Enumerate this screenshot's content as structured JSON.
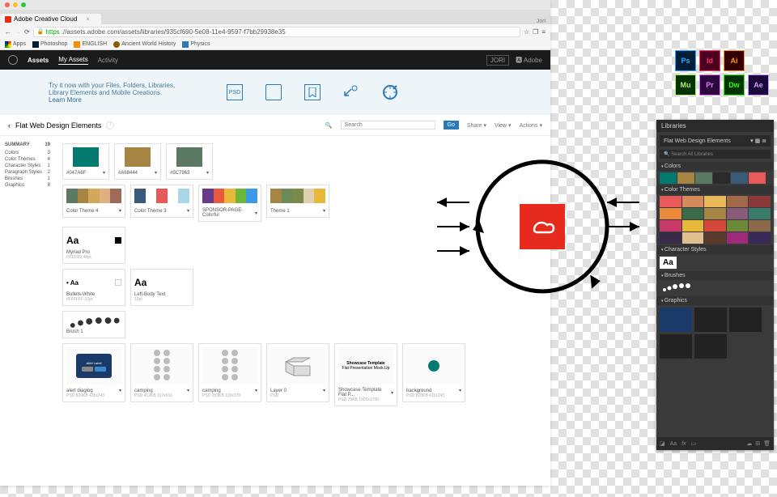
{
  "browser": {
    "tab_title": "Adobe Creative Cloud",
    "url_prefix": "https",
    "url": "://assets.adobe.com/assets/libraries/935cf690-5e08-11e4-9597-f7bb29938e35",
    "user": "Jori",
    "bookmarks": [
      "Apps",
      "Photoshop",
      "ENGLISH",
      "Ancient World History",
      "Physics"
    ]
  },
  "topbar": {
    "brand": "Assets",
    "tabs": [
      "My Assets",
      "Activity"
    ],
    "user": "JORI",
    "adobe": "Adobe"
  },
  "promo": {
    "text": "Try it now with your Files, Folders, Libraries, Library Elements and Mobile Creations.",
    "link": "Learn More",
    "psd": "PSD"
  },
  "crumb": {
    "title": "Flat Web Design Elements",
    "search_ph": "Search",
    "go": "Go",
    "actions": [
      "Share",
      "View",
      "Actions"
    ]
  },
  "summary": {
    "title": "SUMMARY",
    "total": "19",
    "rows": [
      {
        "l": "Colors",
        "n": "3"
      },
      {
        "l": "Color Themes",
        "n": "4"
      },
      {
        "l": "Character Styles",
        "n": "1"
      },
      {
        "l": "Paragraph Styles",
        "n": "2"
      },
      {
        "l": "Brushes",
        "n": "1"
      },
      {
        "l": "Graphics",
        "n": "8"
      }
    ]
  },
  "colors": [
    {
      "hex": "#047A6F",
      "lbl": "#047A6F"
    },
    {
      "hex": "#A68444",
      "lbl": "#A68444"
    },
    {
      "hex": "#5C7963",
      "lbl": "#5C7963"
    }
  ],
  "themes": [
    {
      "name": "Color Theme 4",
      "c": [
        "#5c7963",
        "#a68444",
        "#d4a85a",
        "#e0b080",
        "#a06a5a"
      ]
    },
    {
      "name": "Color Theme 3",
      "c": [
        "#3a5a7a",
        "#ffffff",
        "#e85a5a",
        "#ffffff",
        "#a8d8e8"
      ]
    },
    {
      "name": "SPONSOR-PAGE-Colorful",
      "c": [
        "#6a3a8a",
        "#e85a3a",
        "#e8b83a",
        "#6ab83a",
        "#3a9ae8"
      ]
    },
    {
      "name": "Theme 1",
      "c": [
        "#a68444",
        "#6a8a5a",
        "#7a8a4a",
        "#e0d0b0",
        "#e8b83a"
      ]
    }
  ],
  "charstyles": [
    {
      "name": "Myriad Pro",
      "sub": "#202022   44pt",
      "prev": "Aa",
      "box": true
    },
    {
      "name": "Bullets-White",
      "sub": "#FFFFFF   10pt",
      "prev": "• Aa",
      "prev_small": true
    },
    {
      "name": "Left-Body Text",
      "sub": "10pt",
      "prev": "Aa"
    }
  ],
  "brushes": [
    {
      "name": "Brush 1"
    }
  ],
  "graphics": [
    {
      "name": "alert diaglog",
      "sub": "PSD   820KB  411x243",
      "bg": "#1a3a6a"
    },
    {
      "name": "camping",
      "sub": "PSD   412KB  112x616",
      "icons": true
    },
    {
      "name": "camping",
      "sub": "PSD   253KB  103x370",
      "icons": true
    },
    {
      "name": "Layer 0",
      "sub": "PSD    ",
      "box3d": true
    },
    {
      "name": "Showcase Template Flat P...",
      "sub": "PSD   75KB  1920x1700",
      "text": "Showcase Template",
      "text2": "Flat Presentation Mock.Up"
    },
    {
      "name": "background",
      "sub": "PSD   820KB  411x243",
      "dot": "#047A6F"
    }
  ],
  "apps": [
    {
      "l": "Ps",
      "bg": "#001e36",
      "bd": "#31a8ff"
    },
    {
      "l": "Id",
      "bg": "#49021f",
      "bd": "#ff3366"
    },
    {
      "l": "Ai",
      "bg": "#330000",
      "bd": "#ff9a00"
    },
    {
      "l": "",
      "bg": "",
      "bd": ""
    },
    {
      "l": "Mu",
      "bg": "#003300",
      "bd": "#c0e862"
    },
    {
      "l": "Pr",
      "bg": "#2a0a3a",
      "bd": "#e878ff"
    },
    {
      "l": "Dw",
      "bg": "#003300",
      "bd": "#35fa00"
    },
    {
      "l": "Ae",
      "bg": "#1a0a3a",
      "bd": "#cf96ff"
    }
  ],
  "panel": {
    "title": "Libraries",
    "lib": "Flat Web Design Elements",
    "search_ph": "Search All Libraries",
    "secs": {
      "colors": "Colors",
      "themes": "Color Themes",
      "char": "Character Styles",
      "brush": "Brushes",
      "gfx": "Graphics"
    },
    "colors": [
      "#047A6F",
      "#A68444",
      "#5C7963",
      "#2a2a2a",
      "#3a5a7a",
      "#e85a5a"
    ],
    "themes": [
      "#e85a5a",
      "#d48a5a",
      "#e8b85a",
      "#a06a4a",
      "#8a3a3a",
      "#e88a3a",
      "#3a6a4a",
      "#a68444",
      "#8a5a7a",
      "#3a7a6a",
      "#c83a6a",
      "#e8b83a",
      "#d4483a",
      "#6a8a3a",
      "#8a6a4a",
      "#3a2a4a",
      "#e0c090",
      "#5a3a2a",
      "#a02a7a",
      "#3a2a5a"
    ],
    "char": "Aa"
  }
}
